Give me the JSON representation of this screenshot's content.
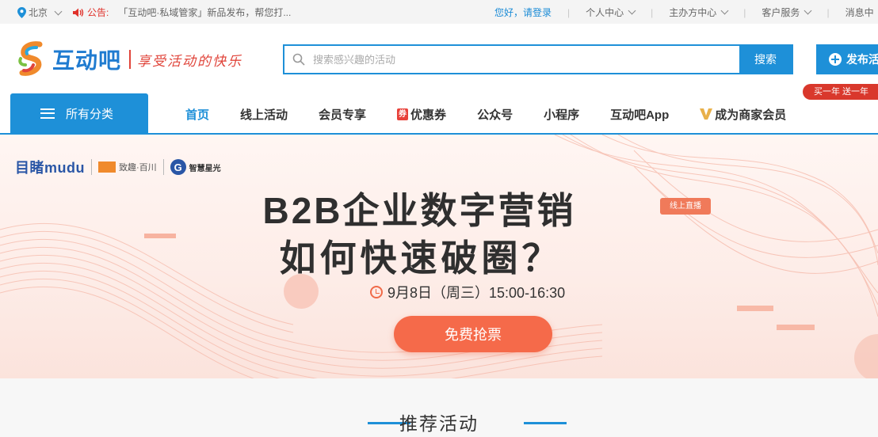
{
  "topbar": {
    "location": "北京",
    "notice_label": "公告:",
    "notice_text": "「互动吧·私域管家」新品发布，帮您打...",
    "greeting": "您好，请登录",
    "links": [
      "个人中心",
      "主办方中心",
      "客户服务",
      "消息中"
    ]
  },
  "header": {
    "logo_name": "互动吧",
    "slogan": "享受活动的快乐",
    "search_placeholder": "搜索感兴趣的活动",
    "search_button": "搜索",
    "publish_button": "发布活"
  },
  "nav": {
    "all_categories": "所有分类",
    "items": [
      "首页",
      "线上活动",
      "会员专享",
      "优惠券",
      "公众号",
      "小程序",
      "互动吧App",
      "成为商家会员"
    ],
    "coupon_icon_char": "券",
    "promo_badge": "买一年 送一年"
  },
  "banner": {
    "brand_mudu": "目睹mudu",
    "brand_2": "致趣·百川",
    "brand_3": "智慧星光",
    "headline_line1": "B2B企业数字营销",
    "headline_line2": "如何快速破圈？",
    "live_tag": "线上直播",
    "time_text": "9月8日（周三）15:00-16:30",
    "cta": "免费抢票"
  },
  "section": {
    "title": "推荐活动"
  },
  "colors": {
    "primary": "#1e90d8",
    "accent_red": "#e0322b",
    "cta": "#f56a4a"
  }
}
